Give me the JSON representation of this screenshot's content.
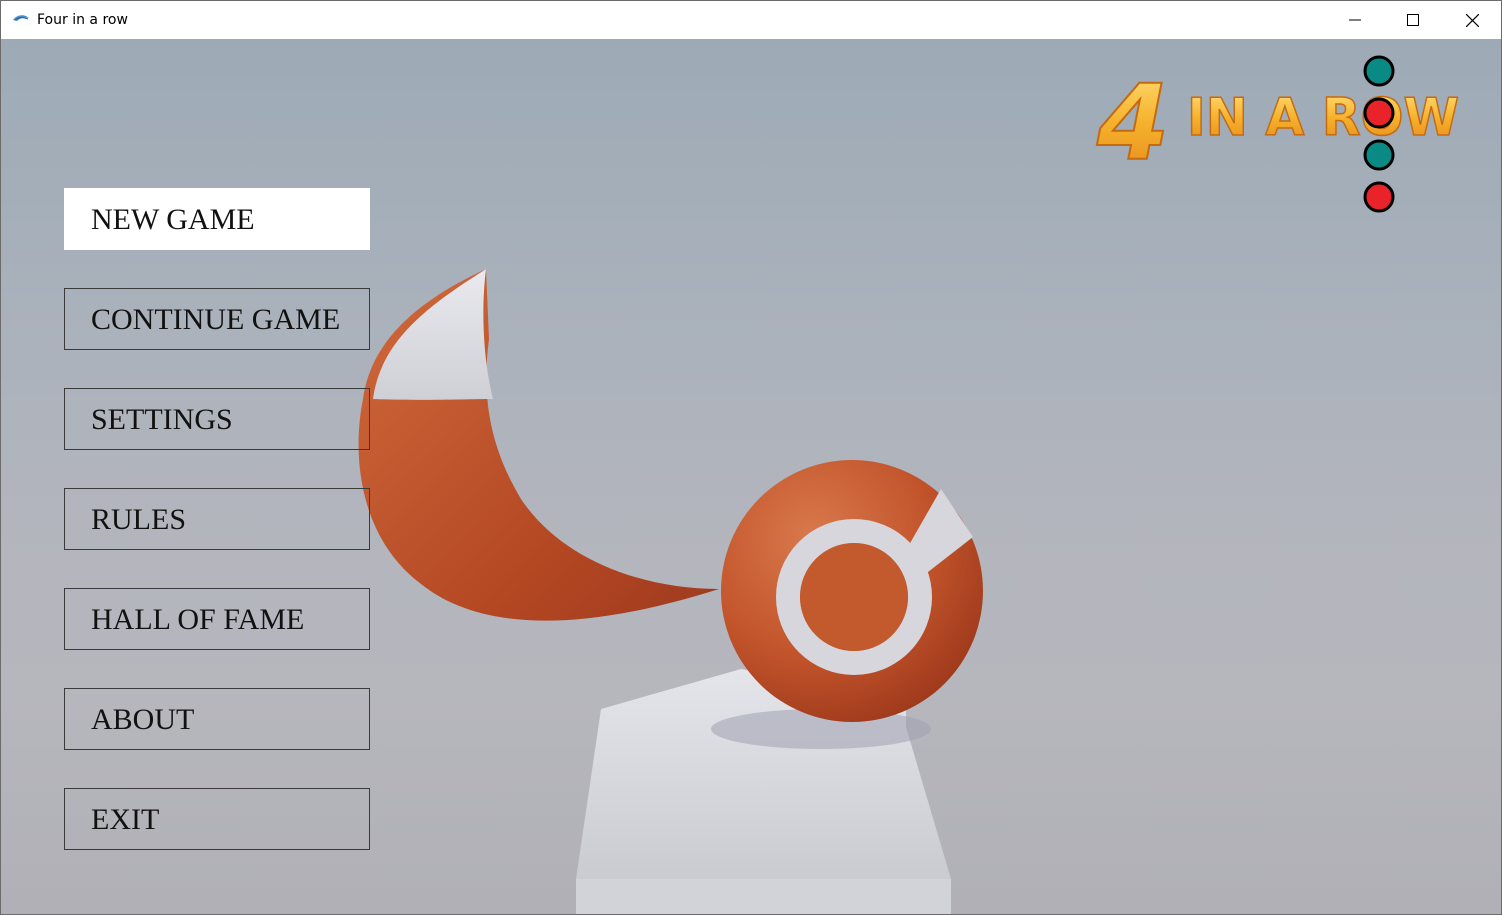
{
  "window": {
    "title": "Four in a row",
    "app_icon": "eye-app-icon",
    "controls": {
      "minimize_icon": "minimize-icon",
      "maximize_icon": "maximize-icon",
      "close_icon": "close-icon"
    }
  },
  "logo": {
    "number": "4",
    "text": "IN A ROW",
    "colors": {
      "gold": "#f2a421",
      "teal": "#0a8a84",
      "red": "#e8242a"
    }
  },
  "menu": {
    "items": [
      {
        "label": "NEW GAME",
        "active": true
      },
      {
        "label": "CONTINUE GAME",
        "active": false
      },
      {
        "label": "SETTINGS",
        "active": false
      },
      {
        "label": "RULES",
        "active": false
      },
      {
        "label": "HALL OF FAME",
        "active": false
      },
      {
        "label": "ABOUT",
        "active": false
      },
      {
        "label": "EXIT",
        "active": false
      }
    ]
  },
  "scene": {
    "accent_color": "#c85a30",
    "background_color": "#adb3bc"
  }
}
